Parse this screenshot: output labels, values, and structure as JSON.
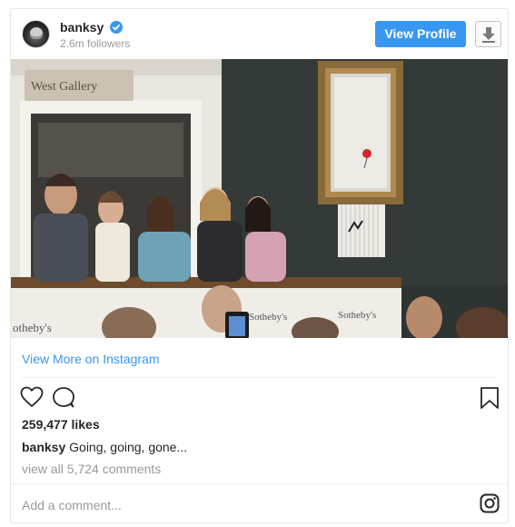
{
  "header": {
    "username": "banksy",
    "followers": "2.6m followers",
    "view_profile_label": "View Profile"
  },
  "photo": {
    "signs": {
      "gallery": "West Gallery",
      "sothebys_left": "otheby's",
      "sothebys_mid": "Sotheby's",
      "sothebys_right": "Sotheby's"
    }
  },
  "view_more_label": "View More on Instagram",
  "likes": "259,477 likes",
  "caption": {
    "user": "banksy",
    "text": "Going, going, gone..."
  },
  "view_comments": "view all 5,724 comments",
  "add_comment_placeholder": "Add a comment...",
  "colors": {
    "accent": "#3897f0",
    "muted": "#999999",
    "text": "#262626"
  },
  "icons": [
    "verified-badge-icon",
    "download-icon",
    "heart-icon",
    "comment-icon",
    "bookmark-icon",
    "instagram-icon"
  ]
}
